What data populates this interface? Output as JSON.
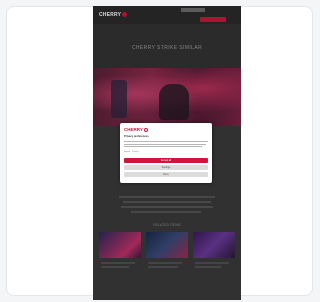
{
  "header": {
    "logo_text": "CHERRY",
    "nav_button_label": ""
  },
  "hero": {
    "title": "CHERRY STRIKE SIMILAR"
  },
  "section": {
    "title": "RELATED ITEMS"
  },
  "consent_modal": {
    "logo_text": "CHERRY",
    "heading": "Privacy preferences",
    "links_text": "Imprint · Privacy",
    "accept_label": "Accept all",
    "settings_label": "Settings",
    "deny_label": "Deny"
  },
  "colors": {
    "brand": "#d2143c",
    "page_background": "#3a3a3a",
    "card_background": "#ffffff"
  }
}
